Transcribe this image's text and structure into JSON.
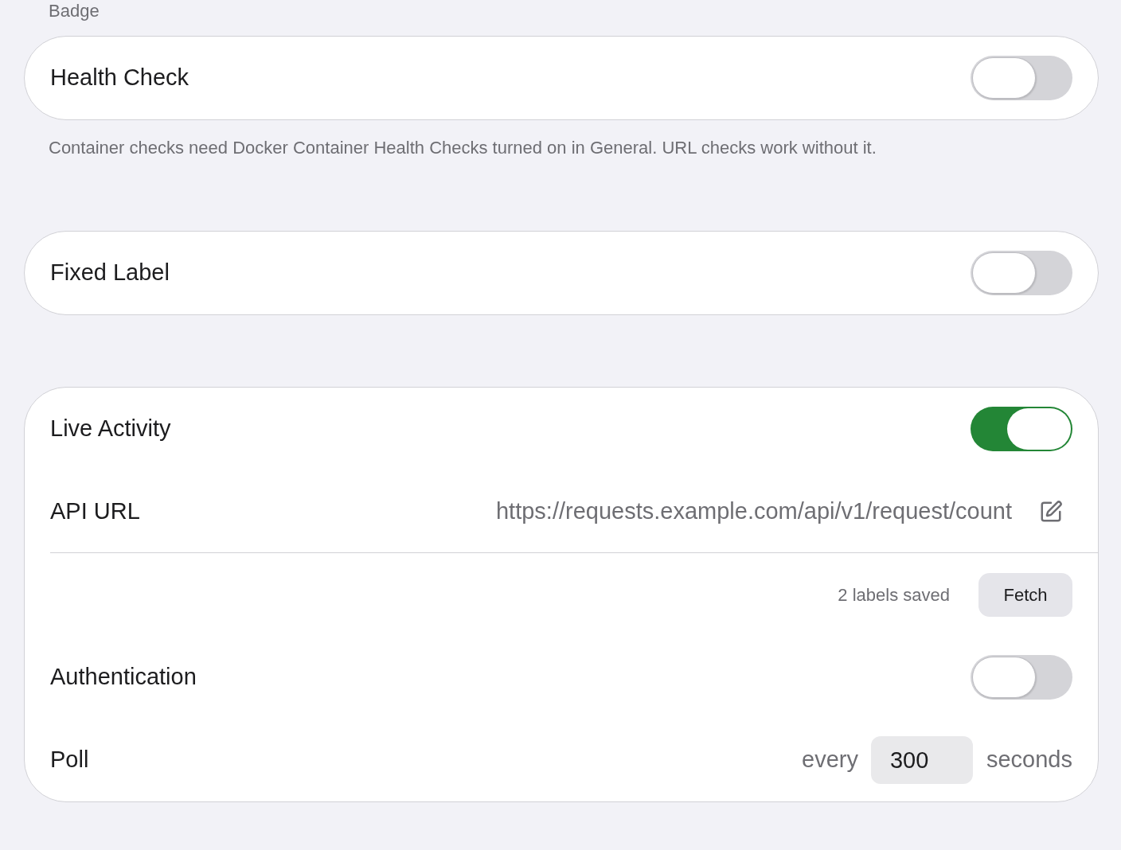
{
  "section_label": "Badge",
  "sections": [
    {
      "rows": [
        {
          "kind": "toggle",
          "label": "Health Check",
          "on": false
        }
      ],
      "footnote": "Container checks need Docker Container Health Checks turned on in General. URL checks work without it."
    },
    {
      "rows": [
        {
          "kind": "toggle",
          "label": "Fixed Label",
          "on": false
        }
      ]
    },
    {
      "rows": [
        {
          "kind": "toggle",
          "label": "Live Activity",
          "on": true
        },
        {
          "kind": "url",
          "label": "API URL",
          "value": "https://requests.example.com/api/v1/request/count"
        },
        {
          "kind": "action",
          "status": "2 labels saved",
          "button": "Fetch"
        },
        {
          "kind": "toggle",
          "label": "Authentication",
          "on": false
        },
        {
          "kind": "number",
          "label": "Poll",
          "prefix": "every",
          "value": "300",
          "suffix": "seconds"
        }
      ]
    }
  ]
}
